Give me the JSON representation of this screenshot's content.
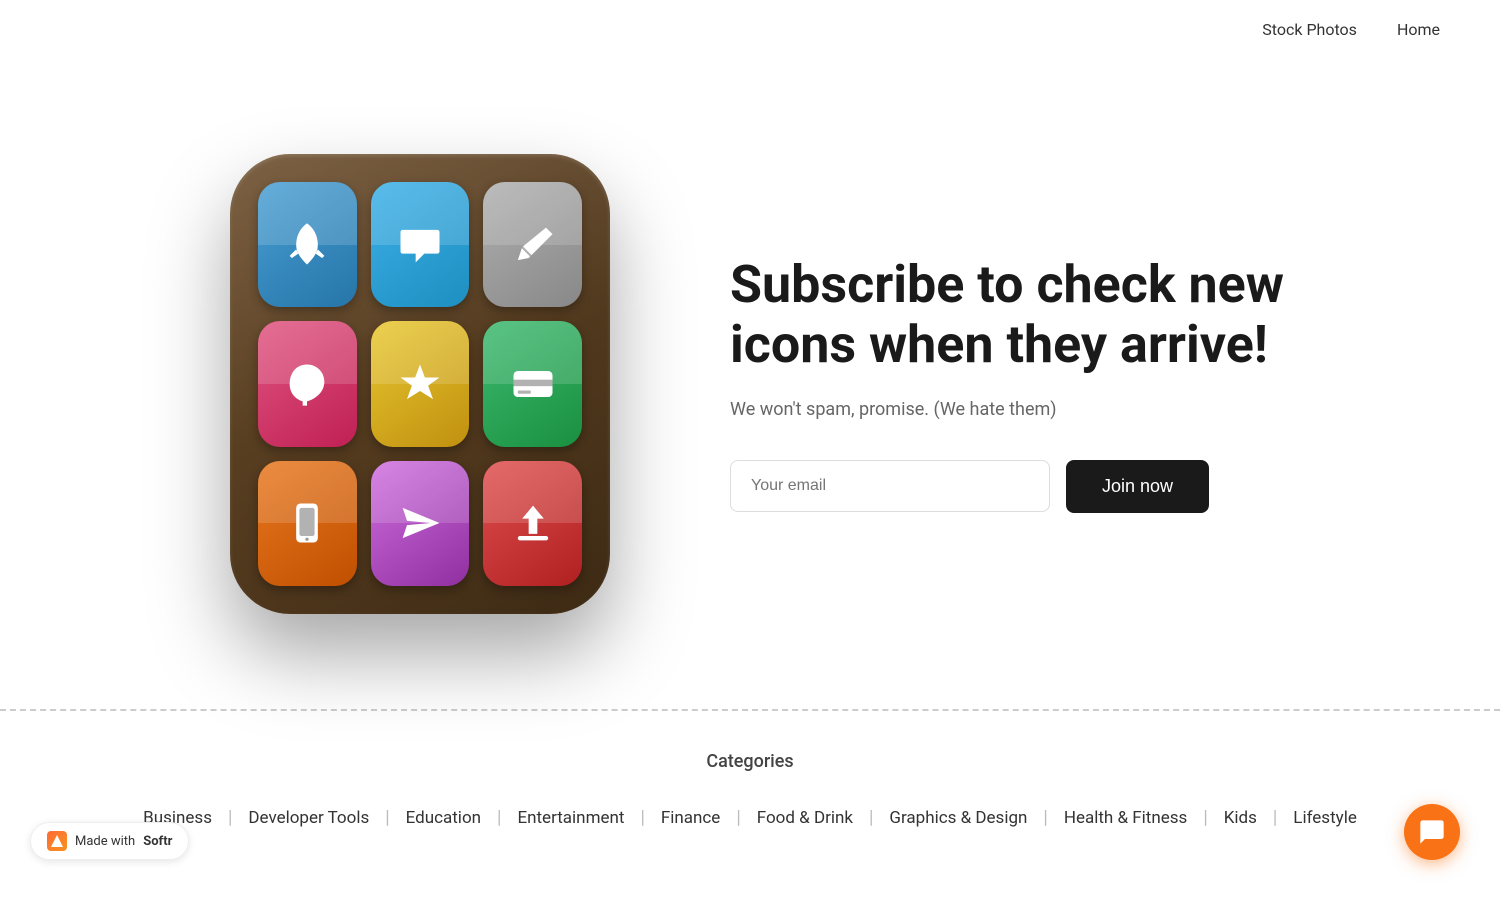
{
  "header": {
    "nav_items": [
      {
        "label": "Stock Photos",
        "href": "#"
      },
      {
        "label": "Home",
        "href": "#"
      }
    ]
  },
  "hero": {
    "title": "Subscribe to check new icons when they arrive!",
    "subtitle": "We won't spam, promise. (We hate them)",
    "email_placeholder": "Your email",
    "join_button_label": "Join now"
  },
  "footer": {
    "categories_label": "Categories",
    "categories": [
      {
        "label": "Business"
      },
      {
        "label": "Developer Tools"
      },
      {
        "label": "Education"
      },
      {
        "label": "Entertainment"
      },
      {
        "label": "Finance"
      },
      {
        "label": "Food & Drink"
      },
      {
        "label": "Graphics & Design"
      },
      {
        "label": "Health & Fitness"
      },
      {
        "label": "Kids"
      },
      {
        "label": "Lifestyle"
      }
    ]
  },
  "softr_badge": {
    "label": "Made with",
    "brand": "Softr"
  },
  "chat_button": {
    "label": "Chat"
  },
  "app_cells": [
    {
      "id": 1,
      "icon": "rocket"
    },
    {
      "id": 2,
      "icon": "chat"
    },
    {
      "id": 3,
      "icon": "pencil"
    },
    {
      "id": 4,
      "icon": "leaf"
    },
    {
      "id": 5,
      "icon": "star"
    },
    {
      "id": 6,
      "icon": "card"
    },
    {
      "id": 7,
      "icon": "phone"
    },
    {
      "id": 8,
      "icon": "send"
    },
    {
      "id": 9,
      "icon": "upload"
    }
  ]
}
